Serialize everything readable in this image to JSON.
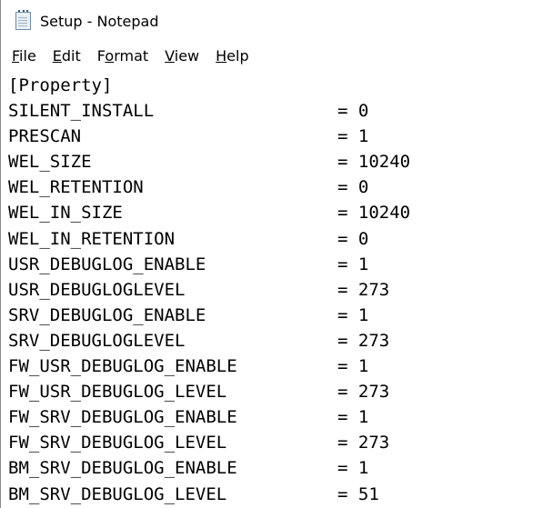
{
  "window": {
    "title": "Setup - Notepad"
  },
  "menu": [
    {
      "first": "F",
      "rest": "ile"
    },
    {
      "first": "E",
      "rest": "dit"
    },
    {
      "first": "",
      "pre": "F",
      "mid": "o",
      "post": "rmat"
    },
    {
      "first": "V",
      "rest": "iew"
    },
    {
      "first": "H",
      "rest": "elp"
    }
  ],
  "content": {
    "section": "[Property]",
    "lines": [
      {
        "key": "SILENT_INSTALL",
        "value": "= 0"
      },
      {
        "key": "PRESCAN",
        "value": "= 1"
      },
      {
        "key": "WEL_SIZE",
        "value": "= 10240"
      },
      {
        "key": "WEL_RETENTION",
        "value": "= 0"
      },
      {
        "key": "WEL_IN_SIZE",
        "value": "= 10240"
      },
      {
        "key": "WEL_IN_RETENTION",
        "value": "= 0"
      },
      {
        "key": "USR_DEBUGLOG_ENABLE",
        "value": "= 1"
      },
      {
        "key": "USR_DEBUGLOGLEVEL",
        "value": "= 273"
      },
      {
        "key": "SRV_DEBUGLOG_ENABLE",
        "value": "= 1"
      },
      {
        "key": "SRV_DEBUGLOGLEVEL",
        "value": "= 273"
      },
      {
        "key": "FW_USR_DEBUGLOG_ENABLE",
        "value": "= 1"
      },
      {
        "key": "FW_USR_DEBUGLOG_LEVEL",
        "value": "= 273"
      },
      {
        "key": "FW_SRV_DEBUGLOG_ENABLE",
        "value": "= 1"
      },
      {
        "key": "FW_SRV_DEBUGLOG_LEVEL",
        "value": "= 273"
      },
      {
        "key": "BM_SRV_DEBUGLOG_ENABLE",
        "value": "= 1"
      },
      {
        "key": "BM_SRV_DEBUGLOG_LEVEL",
        "value": "= 51"
      }
    ]
  }
}
